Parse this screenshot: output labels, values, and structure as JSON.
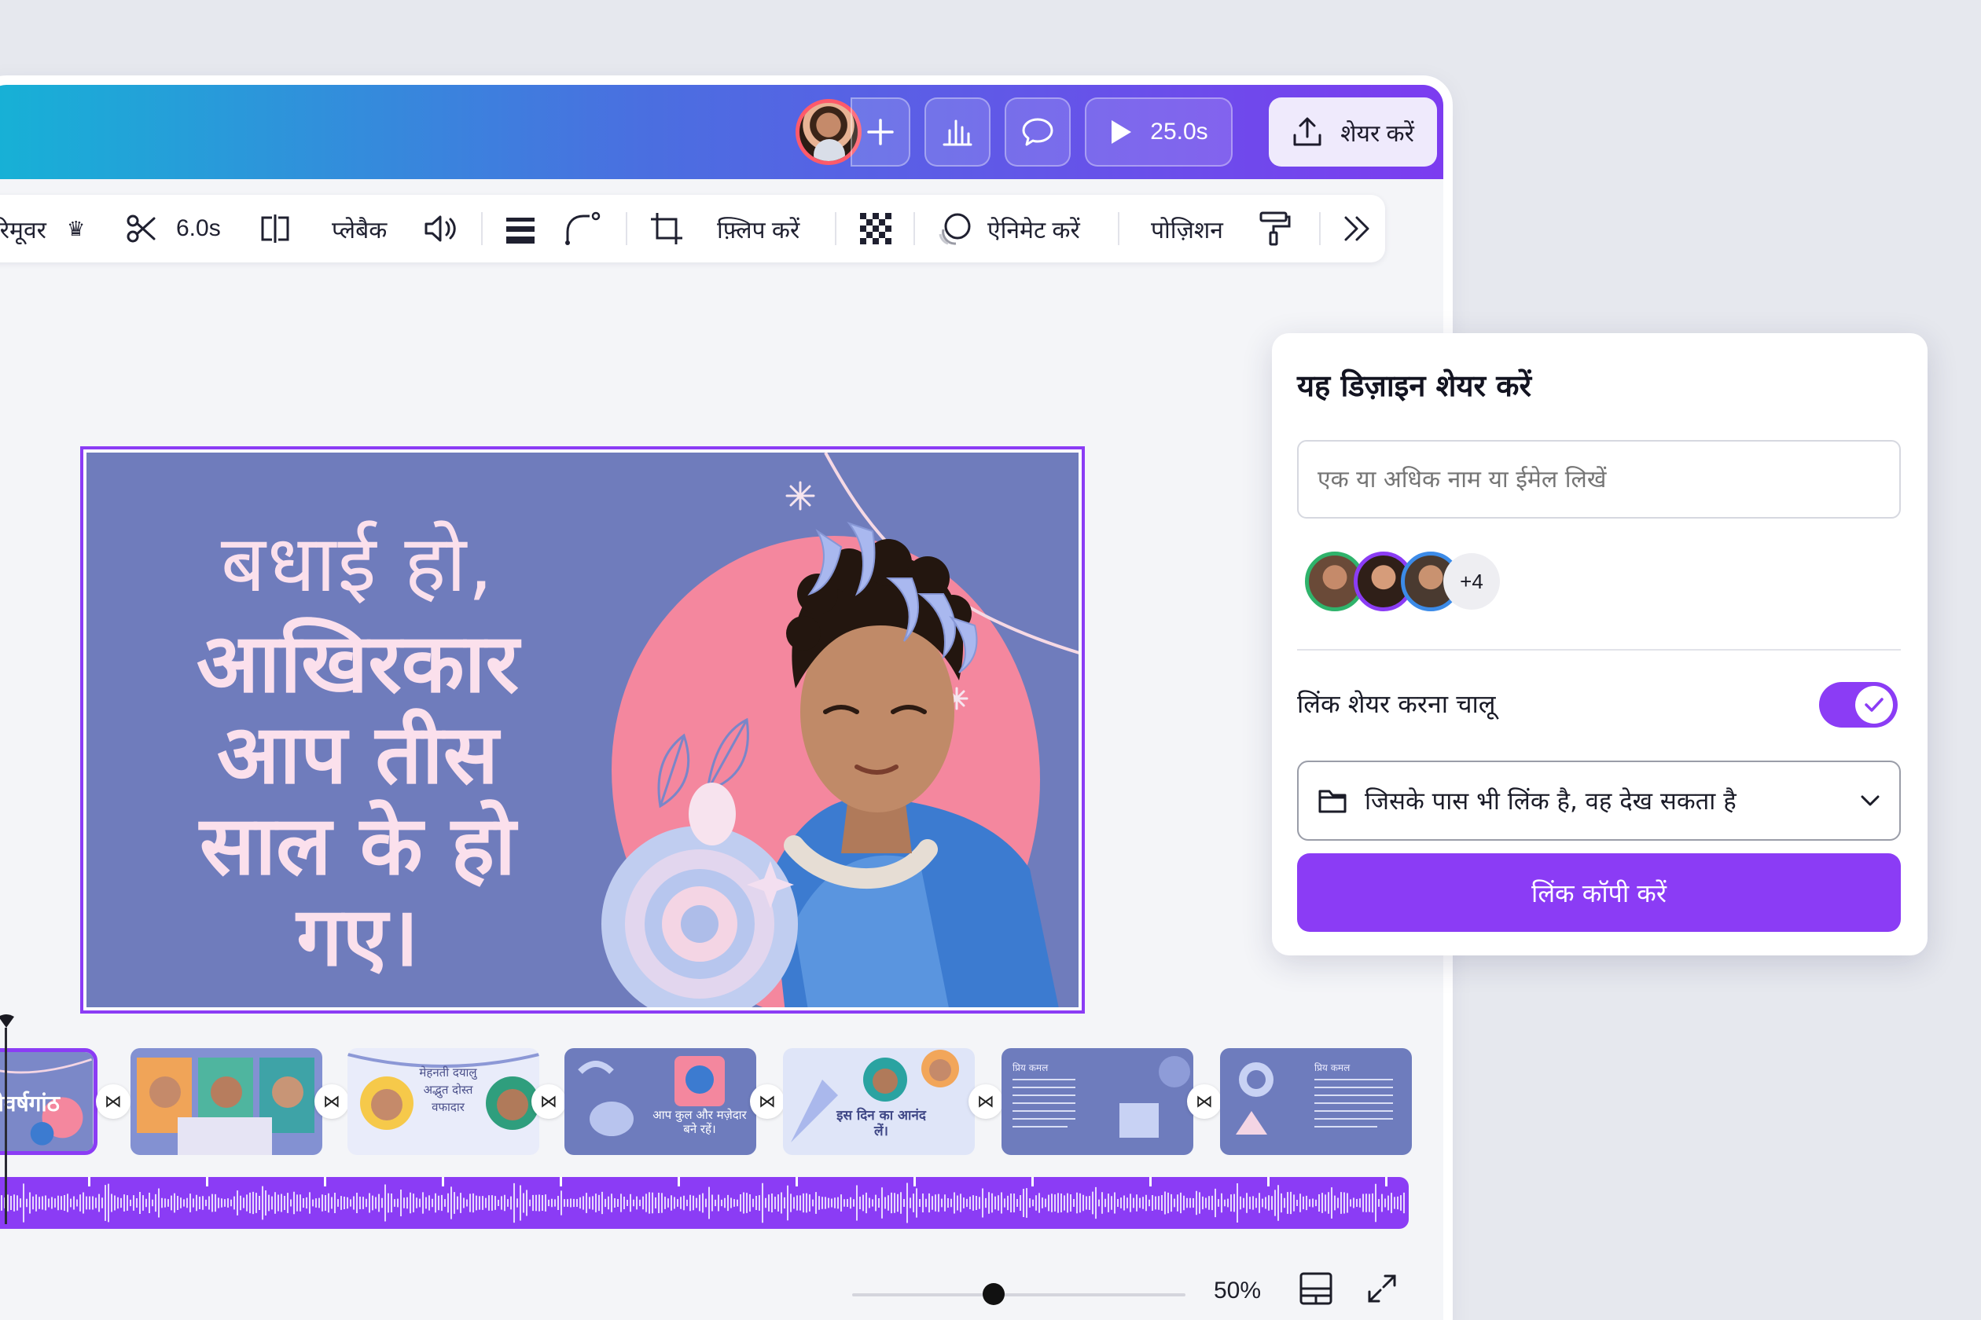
{
  "header": {
    "play_time": "25.0s",
    "share_label": "शेयर करें"
  },
  "toolbar": {
    "bg_remover": "रिमूवर",
    "duration": "6.0s",
    "playback": "प्लेबैक",
    "flip": "फ़्लिप करें",
    "animate": "ऐनिमेट करें",
    "position": "पोज़िशन"
  },
  "design": {
    "line1": "बधाई हो,",
    "line2": "आखिरकार",
    "line3": "आप तीस",
    "line4": "साल के हो",
    "line5": "गए।"
  },
  "timeline": {
    "thumbs": [
      {
        "text": "ीवर्षगांठ"
      },
      {
        "text": ""
      },
      {
        "text": "मेहनती दयालु अद्भुत दोस्त वफादार"
      },
      {
        "text": "आप कुल और मज़ेदार बने रहें।"
      },
      {
        "text": "इस दिन का आनंद लें।"
      },
      {
        "text": "प्रिय कमल"
      },
      {
        "text": "प्रिय कमल"
      }
    ],
    "zoom": "50%",
    "zoom_level": 0.5
  },
  "share_panel": {
    "title": "यह डिज़ाइन शेयर करें",
    "input_placeholder": "एक या अधिक नाम या ईमेल लिखें",
    "more_count": "+4",
    "toggle_label": "लिंक शेयर करना चालू",
    "toggle_on": true,
    "access_text": "जिसके पास भी लिंक है, वह देख सकता है",
    "copy_button": "लिंक कॉपी करें"
  },
  "colors": {
    "accent": "#8b3cf5",
    "design_bg": "#6f7cbc",
    "design_text": "#fbe0ec",
    "blob": "#f4879e"
  }
}
